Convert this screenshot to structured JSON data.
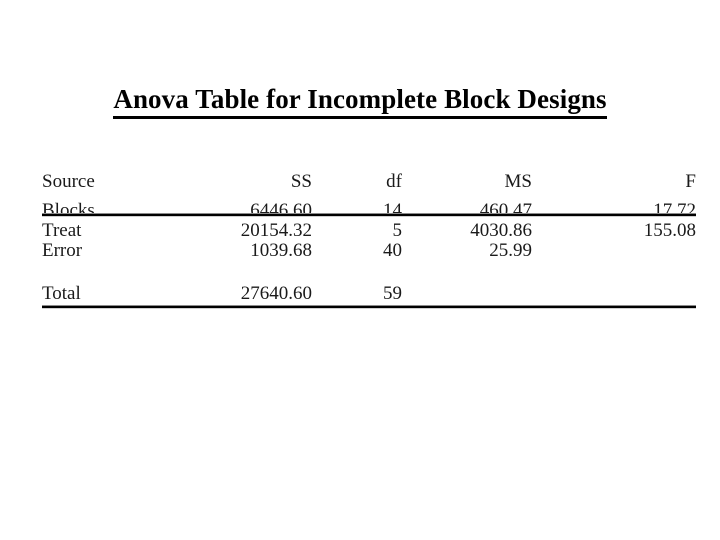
{
  "slide": {
    "title": "Anova Table for Incomplete Block Designs",
    "background_color": "#ffffff",
    "text_color": "#000000",
    "rule_color": "#000000"
  },
  "table": {
    "columns": [
      "Source",
      "SS",
      "df",
      "MS",
      "F"
    ],
    "rows": [
      {
        "source": "Blocks",
        "ss": "6446.60",
        "df": "14",
        "ms": "460.47",
        "f": "17.72"
      },
      {
        "source": "Treat",
        "ss": "20154.32",
        "df": "5",
        "ms": "4030.86",
        "f": "155.08"
      },
      {
        "source": "Error",
        "ss": "1039.68",
        "df": "40",
        "ms": "25.99",
        "f": ""
      }
    ],
    "total": {
      "source": "Total",
      "ss": "27640.60",
      "df": "59",
      "ms": "",
      "f": ""
    }
  }
}
